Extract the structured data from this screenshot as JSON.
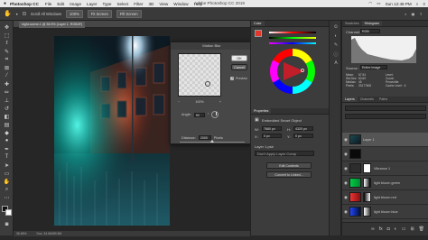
{
  "menubar": {
    "apple_icon": "apple-icon",
    "app_name": "Photoshop CC",
    "items": [
      "File",
      "Edit",
      "Image",
      "Layer",
      "Type",
      "Select",
      "Filter",
      "3D",
      "View",
      "Window",
      "Help"
    ],
    "window_title": "Adobe Photoshop CC 2019",
    "clock": "Sun 12:48 PM"
  },
  "options": {
    "scroll_all": "Scroll All Windows",
    "zoom": "100%",
    "fit_screen": "Fit Screen",
    "fill_screen": "Fill Screen"
  },
  "document": {
    "tab_title": "night-scene-1 @ 36.5% (Layer 1, RGB/8*)",
    "status_zoom": "36.65%",
    "status_doc": "Doc: 34.6M/69.5M"
  },
  "dialog": {
    "title": "Motion Blur",
    "ok": "OK",
    "cancel": "Cancel",
    "preview_label": "Preview",
    "preview_checked": "✓",
    "zoom_value": "100%",
    "zoom_out": "−",
    "zoom_in": "+",
    "angle_label": "Angle:",
    "angle_value": "90",
    "distance_label": "Distance:",
    "distance_value": "2000",
    "distance_unit": "Pixels",
    "distance_fraction": 0.5
  },
  "color_panel": {
    "tab": "Color",
    "foreground": "#e3372c",
    "background": "#ffffff"
  },
  "properties": {
    "tab": "Properties",
    "object_label": "Embedded Smart Object",
    "w_label": "W:",
    "w_value": "7680 px",
    "h_label": "H:",
    "h_value": "4320 px",
    "x_label": "X:",
    "x_value": "0 px",
    "y_label": "Y:",
    "y_value": "0 px",
    "layer_comp": "Layer 1.psb",
    "dont_apply": "Don't Apply Layer Comp",
    "edit_contents": "Edit Contents",
    "convert_linked": "Convert to Linked..."
  },
  "histogram": {
    "tabs": [
      "Swatches",
      "Histogram"
    ],
    "channel_label": "Channel:",
    "channel_value": "RGB",
    "source_label": "Source:",
    "source_value": "Entire Image",
    "mean_label": "Mean:",
    "mean_value": "67.54",
    "std_label": "Std Dev:",
    "std_value": "60.69",
    "median_label": "Median:",
    "median_value": "45",
    "pixels_label": "Pixels:",
    "pixels_value": "33177600",
    "level_label": "Level:",
    "count_label": "Count:",
    "percentile_label": "Percentile:",
    "cache_label": "Cache Level:",
    "cache_value": "6"
  },
  "layers_panel": {
    "tabs": [
      "Layers",
      "Channels",
      "Paths"
    ],
    "layers": [
      {
        "name": "Layer 1",
        "selected": true
      },
      {
        "name": "",
        "selected": false
      },
      {
        "name": "Vibrance 1",
        "selected": false
      },
      {
        "name": "light bloom green",
        "selected": false
      },
      {
        "name": "light bloom red",
        "selected": false
      },
      {
        "name": "light bloom blue",
        "selected": false
      }
    ]
  }
}
